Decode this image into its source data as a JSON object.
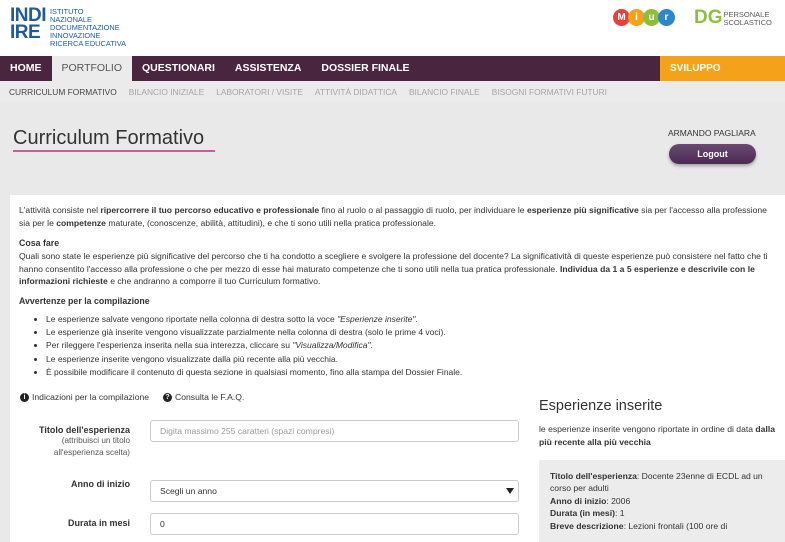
{
  "header": {
    "logo_mark_line1": "INDI",
    "logo_mark_line2": "IRE",
    "logo_text": [
      "ISTITUTO",
      "NAZIONALE",
      "DOCUMENTAZIONE",
      "INNOVAZIONE",
      "RICERCA EDUCATIVA"
    ],
    "miur_letters": [
      "M",
      "i",
      "u",
      "r"
    ],
    "miur_colors": [
      "#e8403a",
      "#f5a21b",
      "#8fbf3a",
      "#2f86c8"
    ],
    "dg_mark": "DG",
    "dg_text_line1": "PERSONALE",
    "dg_text_line2": "SCOLASTICO"
  },
  "mainnav": {
    "items": [
      "HOME",
      "PORTFOLIO",
      "QUESTIONARI",
      "ASSISTENZA",
      "DOSSIER FINALE"
    ],
    "special": "SVILUPPO SOSTENIBILE"
  },
  "subnav": {
    "items": [
      "CURRICULUM FORMATIVO",
      "BILANCIO INIZIALE",
      "LABORATORI / VISITE",
      "ATTIVITÀ DIDATTICA",
      "BILANCIO FINALE",
      "BISOGNI FORMATIVI FUTURI"
    ]
  },
  "page": {
    "title": "Curriculum Formativo",
    "user_name": "ARMANDO PAGLIARA",
    "logout_label": "Logout"
  },
  "intro": {
    "t1": "L'attività consiste nel ",
    "b1": "ripercorrere il tuo percorso educativo e professionale",
    "t2": " fino al ruolo o al passaggio di ruolo, per individuare le ",
    "b2": "esperienze più significative",
    "t3": " sia per l'accesso alla professione sia per le ",
    "b3": "competenze",
    "t4": " maturate, (conoscenze, abilità, attitudini), e che ti sono utili nella pratica professionale."
  },
  "cosa_fare": {
    "heading": "Cosa fare",
    "t1": "Quali sono state le esperienze più significative del percorso che ti ha condotto a scegliere e svolgere la professione del docente? La significatività di queste esperienze può consistere nel fatto che ti hanno consentito l'accesso alla professione o che per mezzo di esse hai maturato competenze che ti sono utili nella tua pratica professionale. ",
    "b1": "Individua da 1 a 5 esperienze e descrivile con le informazioni richieste",
    "t2": " e che andranno a comporre il tuo Curriculum formativo."
  },
  "avvertenze": {
    "heading": "Avvertenze per la compilazione",
    "items": [
      {
        "pre": "Le esperienze salvate vengono riportate nella colonna di destra sotto la voce ",
        "em": "\"Esperienze inserite\"",
        "post": "."
      },
      {
        "pre": "Le esperienze già inserite vengono visualizzate parzialmente nella colonna di destra (solo le prime 4 voci).",
        "em": "",
        "post": ""
      },
      {
        "pre": "Per rileggere l'esperienza inserita nella sua interezza, cliccare su ",
        "em": "\"Visualizza/Modifica\"",
        "post": "."
      },
      {
        "pre": "Le esperienze inserite vengono visualizzate dalla più recente alla più vecchia.",
        "em": "",
        "post": ""
      },
      {
        "pre": "È possibile modificare il contenuto di questa sezione in qualsiasi momento, fino alla stampa del Dossier Finale.",
        "em": "",
        "post": ""
      }
    ]
  },
  "help": {
    "indicazioni": "Indicazioni per la compilazione",
    "faq": "Consulta le F.A.Q."
  },
  "form": {
    "titolo_label": "Titolo dell'esperienza",
    "titolo_sub": "(attribuisci un titolo all'esperienza scelta)",
    "titolo_placeholder": "Digita massimo 255 caratteri (spazi compresi)",
    "anno_label": "Anno di inizio",
    "anno_value": "Scegli un anno",
    "durata_label": "Durata in mesi",
    "durata_value": "0"
  },
  "sidebar": {
    "title": "Esperienze inserite",
    "desc": "le esperienze inserite vengono riportate in ordine di data ",
    "desc_bold": "dalla più recente alla più vecchia",
    "card": {
      "titolo_k": "Titolo dell'esperienza",
      "titolo_v": ": Docente 23enne di ECDL ad un corso per adulti",
      "anno_k": "Anno di inizio",
      "anno_v": ": 2006",
      "durata_k": "Durata (in mesi)",
      "durata_v": ": 1",
      "breve_k": "Breve descrizione",
      "breve_v": ": Lezioni frontali (100 ore di"
    }
  }
}
